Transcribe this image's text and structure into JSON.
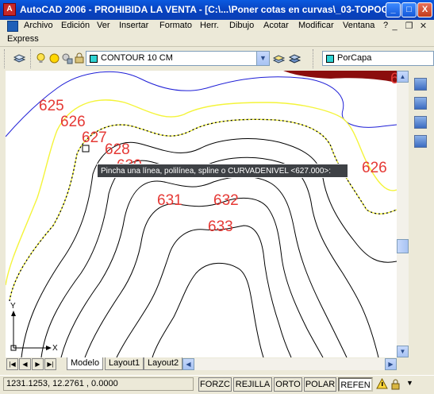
{
  "window": {
    "title": "AutoCAD 2006 - PROHIBIDA LA VENTA - [C:\\...\\Poner cotas en curvas\\_03-TOPOG...",
    "app_icon_label": "A",
    "minimize_label": "_",
    "maximize_label": "□",
    "close_label": "X"
  },
  "menubar": {
    "items": [
      "Archivo",
      "Edición",
      "Ver",
      "Insertar",
      "Formato",
      "Herr.",
      "Dibujo",
      "Acotar",
      "Modificar",
      "Ventana",
      "?"
    ],
    "mdi_minimize": "_",
    "mdi_restore": "❐",
    "mdi_close": "✕"
  },
  "expressbar": {
    "label": "Express"
  },
  "layer_toolbar": {
    "current_layer": "CONTOUR 10 CM",
    "layer_color": "#2fd3d3"
  },
  "properties_toolbar": {
    "color_value": "PorCapa",
    "color_swatch": "#2fd3d3"
  },
  "drawing": {
    "contour_labels": [
      "625",
      "626",
      "627",
      "628",
      "630",
      "631",
      "632",
      "633",
      "626",
      "6"
    ],
    "label_color": "#e53935",
    "tooltip": "Pincha una línea, polilínea, spline o CURVADENIVEL <627.000>:",
    "ucs_x": "X",
    "ucs_y": "Y"
  },
  "tabs": {
    "items": [
      "Modelo",
      "Layout1",
      "Layout2"
    ],
    "active": "Modelo"
  },
  "statusbar": {
    "coordinates": "1231.1253, 12.2761 , 0.0000",
    "buttons": [
      "FORZC",
      "REJILLA",
      "ORTO",
      "POLAR",
      "REFEN"
    ],
    "active_button": "REFEN"
  }
}
